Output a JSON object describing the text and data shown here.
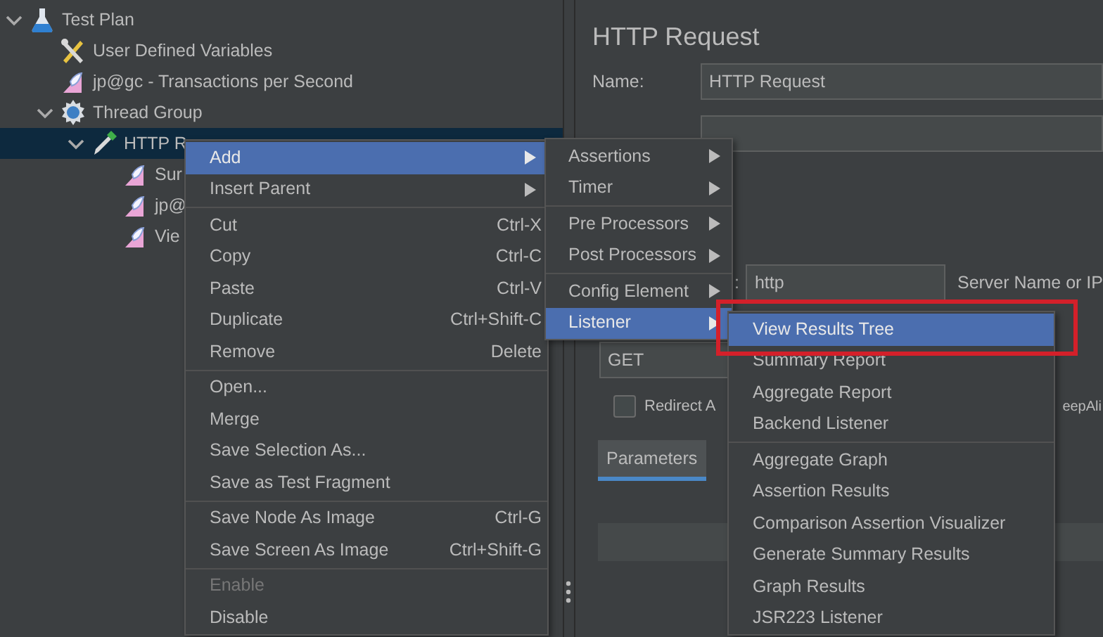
{
  "tree": [
    {
      "label": "Test Plan",
      "kind": "flask",
      "expanded": true,
      "selected": false,
      "children": [
        {
          "label": "User Defined Variables",
          "kind": "tools",
          "selected": false
        },
        {
          "label": "jp@gc - Transactions per Second",
          "kind": "listener",
          "selected": false
        },
        {
          "label": "Thread Group",
          "kind": "gear",
          "expanded": true,
          "selected": false,
          "children": [
            {
              "label": "HTTP R",
              "kind": "pipette",
              "expanded": true,
              "selected": true,
              "children": [
                {
                  "label": "Sur",
                  "kind": "listener",
                  "selected": false
                },
                {
                  "label": "jp@",
                  "kind": "listener",
                  "selected": false
                },
                {
                  "label": "Vie",
                  "kind": "listener",
                  "selected": false
                }
              ]
            }
          ]
        }
      ]
    }
  ],
  "editor": {
    "title": "HTTP Request",
    "name_label": "Name:",
    "name_value": "HTTP Request",
    "protocol_label": ":",
    "protocol_value": "http",
    "server_label": "Server Name or IP",
    "method_value": "GET",
    "redirect_checkbox": {
      "label": "Redirect A",
      "checked": false
    },
    "keepalive_label": "eepAli",
    "tabs": [
      {
        "label": "Parameters",
        "selected": true
      }
    ]
  },
  "context_menu": [
    {
      "kind": "submenu",
      "label": "Add",
      "selected": true,
      "disabled": false
    },
    {
      "kind": "submenu",
      "label": "Insert Parent",
      "selected": false,
      "disabled": false
    },
    {
      "kind": "separator"
    },
    {
      "kind": "item",
      "label": "Cut",
      "shortcut": "Ctrl-X",
      "selected": false,
      "disabled": false
    },
    {
      "kind": "item",
      "label": "Copy",
      "shortcut": "Ctrl-C",
      "selected": false,
      "disabled": false
    },
    {
      "kind": "item",
      "label": "Paste",
      "shortcut": "Ctrl-V",
      "selected": false,
      "disabled": false
    },
    {
      "kind": "item",
      "label": "Duplicate",
      "shortcut": "Ctrl+Shift-C",
      "selected": false,
      "disabled": false
    },
    {
      "kind": "item",
      "label": "Remove",
      "shortcut": "Delete",
      "selected": false,
      "disabled": false
    },
    {
      "kind": "separator"
    },
    {
      "kind": "item",
      "label": "Open...",
      "selected": false,
      "disabled": false
    },
    {
      "kind": "item",
      "label": "Merge",
      "selected": false,
      "disabled": false
    },
    {
      "kind": "item",
      "label": "Save Selection As...",
      "selected": false,
      "disabled": false
    },
    {
      "kind": "item",
      "label": "Save as Test Fragment",
      "selected": false,
      "disabled": false
    },
    {
      "kind": "separator"
    },
    {
      "kind": "item",
      "label": "Save Node As Image",
      "shortcut": "Ctrl-G",
      "selected": false,
      "disabled": false
    },
    {
      "kind": "item",
      "label": "Save Screen As Image",
      "shortcut": "Ctrl+Shift-G",
      "selected": false,
      "disabled": false
    },
    {
      "kind": "separator"
    },
    {
      "kind": "item",
      "label": "Enable",
      "selected": false,
      "disabled": true
    },
    {
      "kind": "item",
      "label": "Disable",
      "selected": false,
      "disabled": false
    }
  ],
  "add_menu": [
    {
      "kind": "submenu",
      "label": "Assertions",
      "selected": false
    },
    {
      "kind": "submenu",
      "label": "Timer",
      "selected": false
    },
    {
      "kind": "separator"
    },
    {
      "kind": "submenu",
      "label": "Pre Processors",
      "selected": false
    },
    {
      "kind": "submenu",
      "label": "Post Processors",
      "selected": false
    },
    {
      "kind": "separator"
    },
    {
      "kind": "submenu",
      "label": "Config Element",
      "selected": false
    },
    {
      "kind": "submenu",
      "label": "Listener",
      "selected": true
    }
  ],
  "listener_menu": [
    {
      "kind": "item",
      "label": "View Results Tree",
      "selected": true,
      "outlined": true
    },
    {
      "kind": "item",
      "label": "Summary Report",
      "selected": false,
      "outlined": false
    },
    {
      "kind": "item",
      "label": "Aggregate Report",
      "selected": false,
      "outlined": false
    },
    {
      "kind": "item",
      "label": "Backend Listener",
      "selected": false,
      "outlined": false
    },
    {
      "kind": "separator"
    },
    {
      "kind": "item",
      "label": "Aggregate Graph",
      "selected": false,
      "outlined": false
    },
    {
      "kind": "item",
      "label": "Assertion Results",
      "selected": false,
      "outlined": false
    },
    {
      "kind": "item",
      "label": "Comparison Assertion Visualizer",
      "selected": false,
      "outlined": false
    },
    {
      "kind": "item",
      "label": "Generate Summary Results",
      "selected": false,
      "outlined": false
    },
    {
      "kind": "item",
      "label": "Graph Results",
      "selected": false,
      "outlined": false
    },
    {
      "kind": "item",
      "label": "JSR223 Listener",
      "selected": false,
      "outlined": false
    }
  ]
}
